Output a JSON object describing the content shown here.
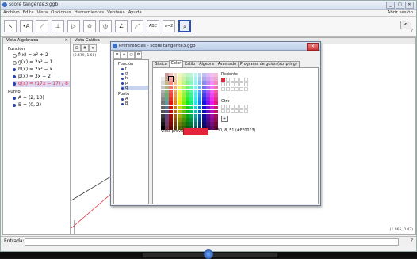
{
  "window": {
    "title": "score tangente3.ggb",
    "controls": [
      "_",
      "□",
      "✕"
    ]
  },
  "menu": {
    "items": [
      "Archivo",
      "Edita",
      "Vista",
      "Opciones",
      "Herramientas",
      "Ventana",
      "Ayuda"
    ],
    "right": "Abrir sesión"
  },
  "toolbar": {
    "tools": [
      {
        "name": "move-tool",
        "glyph": "↖"
      },
      {
        "name": "point-tool",
        "glyph": "•A"
      },
      {
        "name": "line-tool",
        "glyph": "⟋"
      },
      {
        "name": "perpendicular-tool",
        "glyph": "⊥"
      },
      {
        "name": "polygon-tool",
        "glyph": "▷"
      },
      {
        "name": "circle-tool",
        "glyph": "⊙"
      },
      {
        "name": "ellipse-tool",
        "glyph": "◎"
      },
      {
        "name": "angle-tool",
        "glyph": "∠"
      },
      {
        "name": "reflect-tool",
        "glyph": "⋰"
      },
      {
        "name": "text-tool",
        "glyph": "ABC"
      },
      {
        "name": "slider-tool",
        "glyph": "a=2"
      },
      {
        "name": "zoom-tool",
        "glyph": "⌕"
      }
    ],
    "undo_label": "↶",
    "undo_caption": "?"
  },
  "algebra": {
    "header": "Vista Algebraica",
    "function_group": "Función",
    "functions": [
      {
        "label": "f(x) = x² + 2",
        "filled": false
      },
      {
        "label": "g(x) = 2x² − 1",
        "filled": false
      },
      {
        "label": "h(x) = 2x² − x",
        "filled": true
      },
      {
        "label": "p(x) = 3x − 2",
        "filled": true
      },
      {
        "label": "q(x) = (17x − 17) / 8",
        "filled": true,
        "highlight": true
      }
    ],
    "point_group": "Punto",
    "points": [
      "A = (2, 10)",
      "B = (0, 2)"
    ]
  },
  "graphics": {
    "header": "Vista Gráfica",
    "coords_tl": "(0.479, 1.60)",
    "coords_br": "(1.965, 0.43)"
  },
  "input": {
    "label": "Entrada:",
    "help": "?"
  },
  "dialog": {
    "title": "Preferencias - score tangente3.ggb",
    "tree": {
      "function_group": "Función",
      "functions": [
        "f",
        "g",
        "h",
        "p",
        "q"
      ],
      "point_group": "Punto",
      "points": [
        "A",
        "B"
      ],
      "selected": "q"
    },
    "tabs": [
      "Básico",
      "Color",
      "Estilo",
      "Álgebra",
      "Avanzado",
      "Programa de guion (scripting)"
    ],
    "active_tab": "Color",
    "recent_label": "Reciente",
    "other_label": "Otro",
    "plus": "+",
    "preview_label": "Vista previa:",
    "preview_color": "#e3243b",
    "preview_value": "230, 8, 51 (#FF0033)"
  }
}
